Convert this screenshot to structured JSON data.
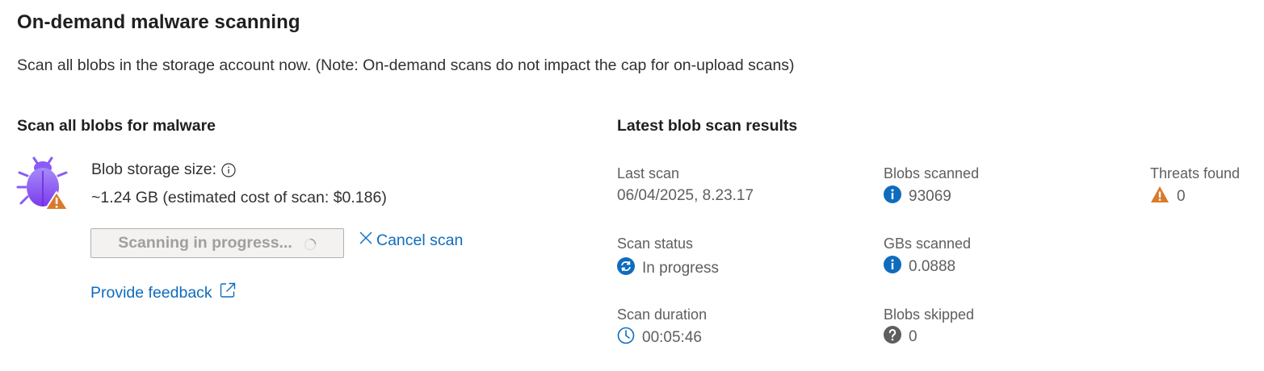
{
  "page": {
    "title": "On-demand malware scanning",
    "description": "Scan all blobs in the storage account now. (Note: On-demand scans do not impact the cap for on-upload scans)"
  },
  "scan_section": {
    "title": "Scan all blobs for malware",
    "icon": "bug-warning-icon",
    "storage_size_label": "Blob storage size:",
    "storage_size_value": "~1.24 GB (estimated cost of scan: $0.186)",
    "scan_button_label": "Scanning in progress...",
    "cancel_label": "Cancel scan",
    "feedback_label": "Provide feedback"
  },
  "results": {
    "title": "Latest blob scan results",
    "last_scan": {
      "label": "Last scan",
      "value": "06/04/2025, 8.23.17"
    },
    "scan_status": {
      "label": "Scan status",
      "value": "In progress",
      "icon": "sync-icon"
    },
    "scan_duration": {
      "label": "Scan duration",
      "value": "00:05:46",
      "icon": "clock-icon"
    },
    "blobs_scanned": {
      "label": "Blobs scanned",
      "value": "93069",
      "icon": "info-icon"
    },
    "gbs_scanned": {
      "label": "GBs scanned",
      "value": "0.0888",
      "icon": "info-icon"
    },
    "blobs_skipped": {
      "label": "Blobs skipped",
      "value": "0",
      "icon": "question-icon"
    },
    "threats_found": {
      "label": "Threats found",
      "value": "0",
      "icon": "warning-icon"
    }
  },
  "colors": {
    "link": "#0f6cbd",
    "info_blue": "#0f6cbd",
    "warning_orange": "#d97a2b",
    "bug_purple": "#8b5cf6",
    "muted_gray": "#605e5c"
  }
}
